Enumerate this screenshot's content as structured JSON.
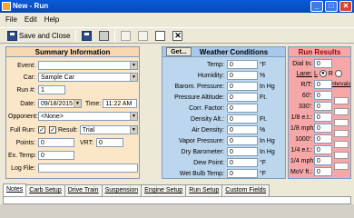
{
  "window": {
    "title": "New - Run"
  },
  "menu": [
    "File",
    "Edit",
    "Help"
  ],
  "toolbar": {
    "save_close": "Save and Close"
  },
  "summary": {
    "title": "Summary Information",
    "event_label": "Event:",
    "event_value": "",
    "car_label": "Car:",
    "car_value": "Sample Car",
    "run_label": "Run #:",
    "run_value": "1",
    "date_label": "Date:",
    "date_value": "09/18/2015",
    "time_label": "Time:",
    "time_value": "11:22 AM",
    "opponent_label": "Opponent:",
    "opponent_value": "<None>",
    "fullrun_label": "Full Run:",
    "result_label": "Result:",
    "result_value": "Trial",
    "points_label": "Points:",
    "points_value": "0",
    "vrt_label": "VRT:",
    "vrt_value": "0",
    "extemp_label": "Ex. Temp:",
    "extemp_value": "0",
    "logfile_label": "Log File:",
    "logfile_value": ""
  },
  "weather": {
    "title": "Weather Conditions",
    "get_label": "Get...",
    "rows": [
      {
        "label": "Temp:",
        "value": "0",
        "unit": "°F"
      },
      {
        "label": "Humidity:",
        "value": "0",
        "unit": "%"
      },
      {
        "label": "Barom. Pressure:",
        "value": "0",
        "unit": "In Hg"
      },
      {
        "label": "Pressure Altitude:",
        "value": "0",
        "unit": "Ft."
      },
      {
        "label": "Corr. Factor:",
        "value": "0",
        "unit": ""
      },
      {
        "label": "Density Alt.:",
        "value": "0",
        "unit": "Ft."
      },
      {
        "label": "Air Density:",
        "value": "0",
        "unit": "%"
      },
      {
        "label": "Vapor Pressure:",
        "value": "0",
        "unit": "In Hg"
      },
      {
        "label": "Dry Barometer:",
        "value": "0",
        "unit": "In Hg"
      },
      {
        "label": "Dew Point:",
        "value": "0",
        "unit": "°F"
      },
      {
        "label": "Wet Bulb Temp:",
        "value": "0",
        "unit": "°F"
      }
    ]
  },
  "results": {
    "title": "Run Results",
    "dial_label": "Dial In:",
    "dial_value": "0",
    "lane_label": "Lane:",
    "lane_l": "L",
    "lane_r": "R",
    "intervals_label": "intervals",
    "rows": [
      {
        "label": "R/T:",
        "value": "0"
      },
      {
        "label": "60':",
        "value": "0"
      },
      {
        "label": "330':",
        "value": "0"
      },
      {
        "label": "1/8 e.t.:",
        "value": "0"
      },
      {
        "label": "1/8 mph:",
        "value": "0"
      },
      {
        "label": "1000':",
        "value": "0"
      },
      {
        "label": "1/4 e.t.:",
        "value": "0"
      },
      {
        "label": "1/4 mph:",
        "value": "0"
      },
      {
        "label": "MoV ft.:",
        "value": "0"
      }
    ]
  },
  "tabs": [
    "Notes",
    "Carb Setup",
    "Drive Train",
    "Suspension",
    "Engine Setup",
    "Run Setup",
    "Custom Fields"
  ]
}
